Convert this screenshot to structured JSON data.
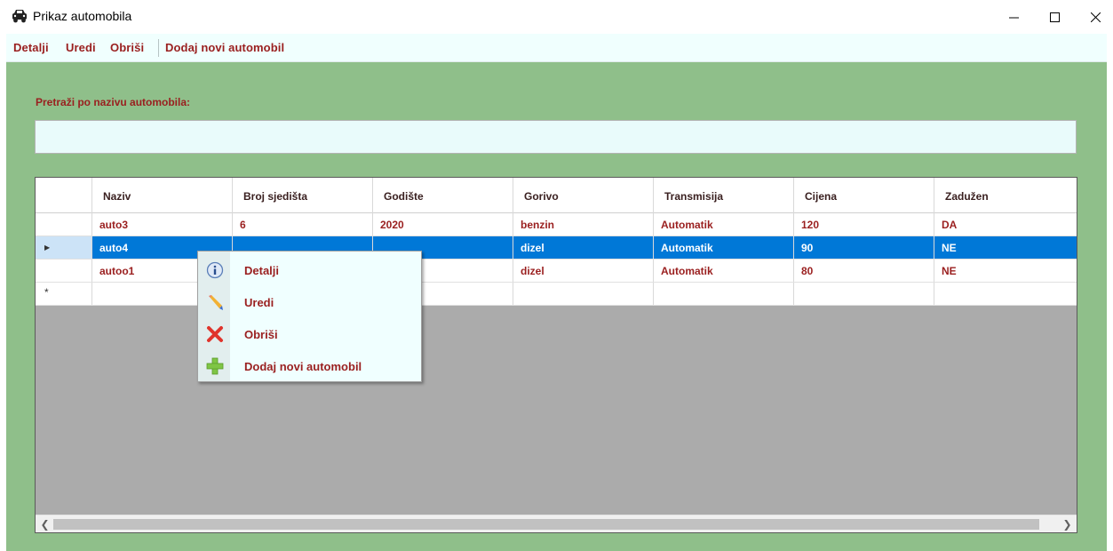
{
  "window": {
    "title": "Prikaz automobila",
    "icon": "car-icon",
    "controls": [
      "minimize-icon",
      "maximize-icon",
      "close-icon"
    ]
  },
  "menu": {
    "details": "Detalji",
    "edit": "Uredi",
    "delete": "Obriši",
    "add_new": "Dodaj novi automobil"
  },
  "search": {
    "label": "Pretraži po nazivu automobila:",
    "value": ""
  },
  "grid": {
    "columns": [
      "Naziv",
      "Broj sjedišta",
      "Godište",
      "Gorivo",
      "Transmisija",
      "Cijena",
      "Zadužen"
    ],
    "rows": [
      {
        "naziv": "auto3",
        "broj_sjedista": "6",
        "godiste": "2020",
        "gorivo": "benzin",
        "transmisija": "Automatik",
        "cijena": "120",
        "zaduzen": "DA"
      },
      {
        "naziv": "auto4",
        "broj_sjedista": "",
        "godiste": "",
        "gorivo": "dizel",
        "transmisija": "Automatik",
        "cijena": "90",
        "zaduzen": "NE"
      },
      {
        "naziv": "autoo1",
        "broj_sjedista": "",
        "godiste": "",
        "gorivo": "dizel",
        "transmisija": "Automatik",
        "cijena": "80",
        "zaduzen": "NE"
      }
    ],
    "selected_row": 1,
    "new_row_marker": "*",
    "current_row_marker": "▶"
  },
  "context_menu": {
    "items": [
      {
        "label": "Detalji",
        "icon": "info-icon"
      },
      {
        "label": "Uredi",
        "icon": "pencil-icon"
      },
      {
        "label": "Obriši",
        "icon": "delete-x-icon"
      },
      {
        "label": "Dodaj novi automobil",
        "icon": "add-plus-icon"
      }
    ]
  },
  "colors": {
    "accent_text": "#9a1f1f",
    "client_bg": "#8fbf8a",
    "selection": "#0078d7",
    "menu_bg": "#f0fffe"
  }
}
